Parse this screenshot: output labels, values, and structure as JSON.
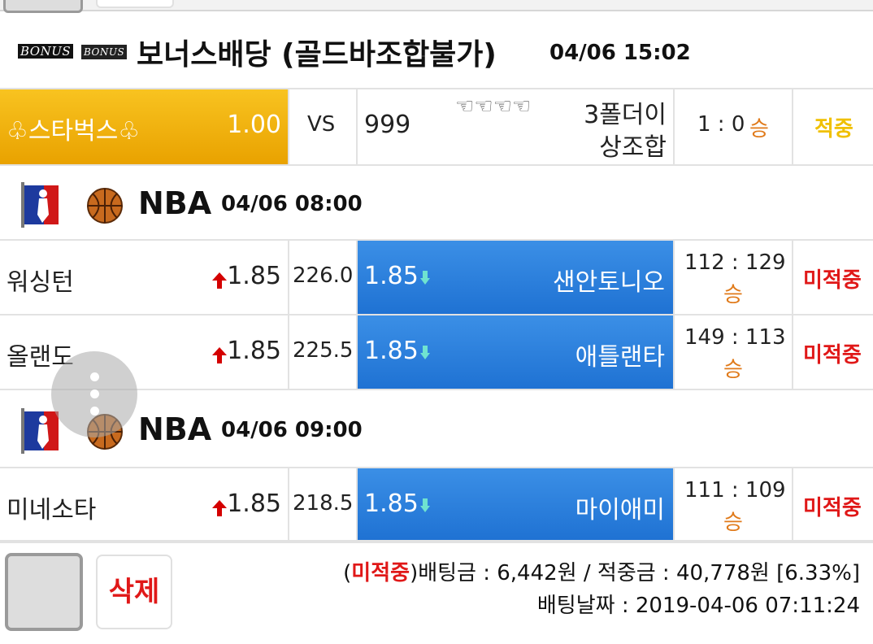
{
  "bonus_section": {
    "badge1": "BONUS",
    "badge2": "BONUS",
    "title": "보너스배당 (골드바조합불가)",
    "time": "04/06 15:02",
    "row": {
      "home": "♧스타벅스♧",
      "home_odds": "1.00",
      "vs": "VS",
      "away_odds": "999",
      "away_icons": "☜☜☜☜",
      "away_line1": "3폴더이",
      "away_line2": "상조합",
      "score": "1 : 0",
      "result_word": "승",
      "status": "적중"
    }
  },
  "games": [
    {
      "league": "NBA",
      "time": "04/06 08:00",
      "rows": [
        {
          "home": "워싱턴",
          "home_odds": "1.85",
          "line": "226.0",
          "away_odds": "1.85",
          "away": "샌안토니오",
          "score": "112 : 129",
          "result_word": "승",
          "status": "미적중"
        },
        {
          "home": "올랜도",
          "home_odds": "1.85",
          "line": "225.5",
          "away_odds": "1.85",
          "away": "애틀랜타",
          "score": "149 : 113",
          "result_word": "승",
          "status": "미적중"
        }
      ]
    },
    {
      "league": "NBA",
      "time": "04/06 09:00",
      "rows": [
        {
          "home": "미네소타",
          "home_odds": "1.85",
          "line": "218.5",
          "away_odds": "1.85",
          "away": "마이애미",
          "score": "111 : 109",
          "result_word": "승",
          "status": "미적중"
        }
      ]
    }
  ],
  "footer": {
    "delete_label": "삭제",
    "paren_open": "(",
    "status": "미적중",
    "bet_summary": ")배팅금 : 6,442원 / 적중금 : 40,778원 [6.33%]",
    "bet_date": "배팅날짜 : 2019-04-06 07:11:24"
  },
  "colors": {
    "gold": "#f0b000",
    "blue": "#2a80dc",
    "miss_red": "#e01818",
    "win_orange": "#e07a1a",
    "hit_yellow": "#f0c000"
  },
  "icons": [
    "nba-logo-icon",
    "basketball-icon",
    "up-arrow-icon",
    "down-arrow-icon",
    "pointing-hand-icon",
    "more-vertical-icon"
  ]
}
